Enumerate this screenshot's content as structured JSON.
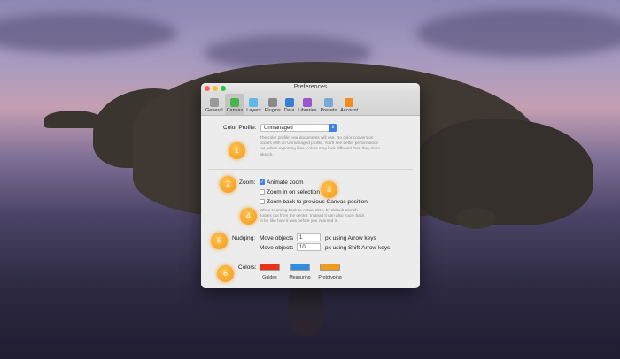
{
  "window": {
    "title": "Preferences",
    "traffic_lights": [
      "#ff5f57",
      "#febc2e",
      "#28c840"
    ]
  },
  "toolbar": [
    {
      "label": "General",
      "icon": "general-icon",
      "color": "#9a9a9a"
    },
    {
      "label": "Canvas",
      "icon": "canvas-icon",
      "color": "#47b54a",
      "active": true
    },
    {
      "label": "Layers",
      "icon": "layers-icon",
      "color": "#5fb8e6"
    },
    {
      "label": "Plugins",
      "icon": "plugins-icon",
      "color": "#8b8b8b"
    },
    {
      "label": "Data",
      "icon": "data-icon",
      "color": "#3a7fd0"
    },
    {
      "label": "Libraries",
      "icon": "libraries-icon",
      "color": "#9a55c9"
    },
    {
      "label": "Presets",
      "icon": "presets-icon",
      "color": "#79a9d6"
    },
    {
      "label": "Account",
      "icon": "account-icon",
      "color": "#f38d22"
    }
  ],
  "color_profile": {
    "label": "Color Profile:",
    "value": "Unmanaged",
    "help": [
      "The color profile new documents will use. No color conversion",
      "occurs with an Unmanaged profile. You'll see better performance",
      "but, when exporting files, colors may look different than they do in",
      "Sketch."
    ]
  },
  "zoom": {
    "label": "Zoom:",
    "options": [
      {
        "label": "Animate zoom",
        "checked": true
      },
      {
        "label": "Zoom in on selection",
        "checked": false
      },
      {
        "label": "Zoom back to previous Canvas position",
        "checked": false
      }
    ],
    "help": [
      "When zooming back to Actual Size, by default Sketch",
      "zooms out from the center. Instead it can also zoom back",
      "to be like how it was before you zoomed in."
    ]
  },
  "nudging": {
    "label": "Nudging:",
    "rows": [
      {
        "prefix": "Move objects",
        "value": "1",
        "suffix": "px using Arrow keys"
      },
      {
        "prefix": "Move objects",
        "value": "10",
        "suffix": "px using Shift-Arrow keys"
      }
    ]
  },
  "colors": {
    "label": "Colors:",
    "swatches": [
      {
        "label": "Guides",
        "color": "#e8321c"
      },
      {
        "label": "Measuring",
        "color": "#2f8ee0"
      },
      {
        "label": "Prototyping",
        "color": "#f29a1d"
      }
    ]
  },
  "callouts": [
    "1",
    "2",
    "3",
    "4",
    "5",
    "6"
  ]
}
